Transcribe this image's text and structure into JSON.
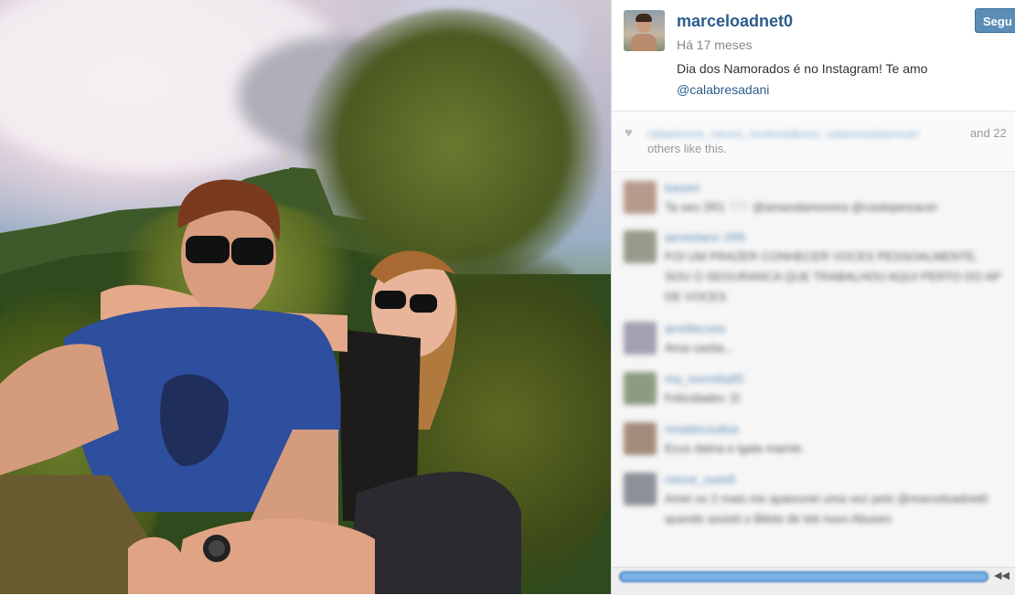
{
  "post": {
    "username": "marceloadnet0",
    "time": "Há 17 meses",
    "caption_text": "Dia dos Namorados é no Instagram! Te amo",
    "caption_mention": "@calabresadani",
    "follow_label": "Segu"
  },
  "likes": {
    "names_blurred": "rafaelmore_neves, muitoolaboss, calamsasbamnan",
    "and_text": "and 22",
    "others_text": "others like this."
  },
  "comments": [
    {
      "name": "loeseri",
      "text": "Ta seu 2R1 ♡♡ @amandamoreira @castejanoacer",
      "avatar_color": "#b79a8c"
    },
    {
      "name": "aeneslano 1R8",
      "text": "FOI UM PRAZER CONHECER VOCES PESSOALMENTE, SOU O SEGURANCA QUE TRABALHOU AQUI PERTO DO AP DE VOCES",
      "avatar_color": "#9a9a8c"
    },
    {
      "name": "arrelilecoes",
      "text": "Ama casita...",
      "avatar_color": "#a4a0b0"
    },
    {
      "name": "ma_morrelia85",
      "text": "Felicidades :D",
      "avatar_color": "#8c9c80"
    },
    {
      "name": "mnatiecoutlue",
      "text": "Ecus datna e lgala mamie.",
      "avatar_color": "#a48c7c"
    },
    {
      "name": "nesoe_sueell",
      "text": "Amei os 2 mais me apaixonei uma vez pelo @marceloadnet0 quando assisti o Bilete de teti nuvo Abuoes",
      "avatar_color": "#8c9098"
    }
  ],
  "colors": {
    "link": "#2c5d8c",
    "follow_button": "#5b8db7",
    "scrollbar": "#7db3e6"
  },
  "icons": {
    "heart": "heart-icon",
    "scroll_left": "arrow-left-icon"
  }
}
